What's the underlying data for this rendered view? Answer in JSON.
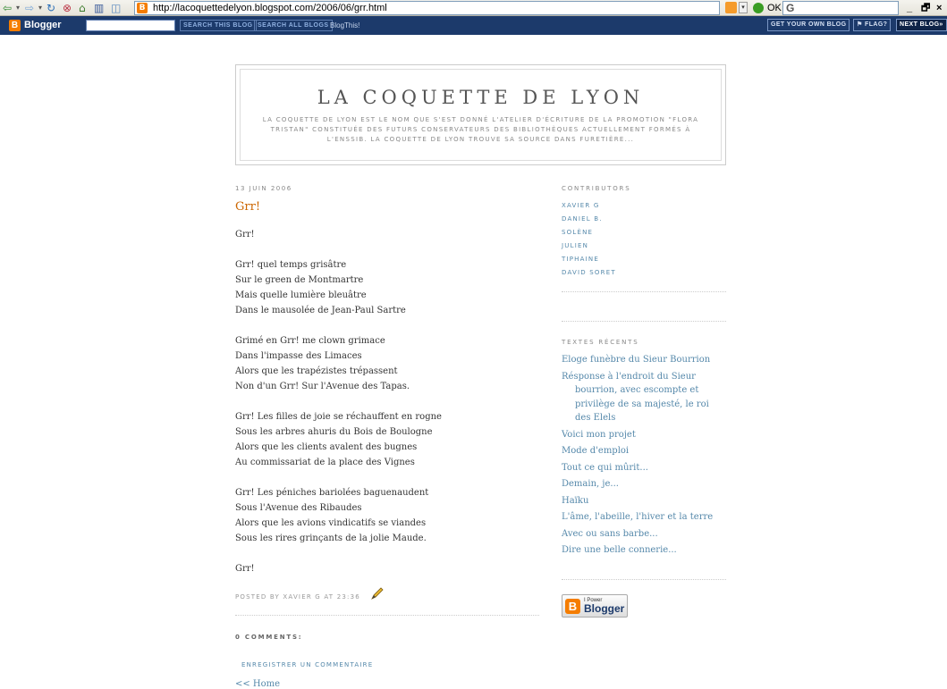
{
  "browser": {
    "url": "http://lacoquettedelyon.blogspot.com/2006/06/grr.html",
    "favicon_letter": "B",
    "go_label": "OK",
    "search_glyph": "G",
    "icons": [
      "back-arrow-icon",
      "forward-arrow-icon",
      "refresh-icon",
      "stop-icon",
      "home-icon",
      "media-icon"
    ]
  },
  "navbar": {
    "logo_letter": "B",
    "logo_text": "Blogger",
    "search_this_blog": "SEARCH THIS BLOG",
    "search_all_blogs": "SEARCH ALL BLOGS",
    "blogthis": "BlogThis!",
    "get_own_blog": "GET YOUR OWN BLOG",
    "flag": "⚑ FLAG?",
    "next_blog": "NEXT BLOG»"
  },
  "header": {
    "title": "LA COQUETTE DE LYON",
    "description": "LA COQUETTE DE LYON EST LE NOM QUE S'EST DONNÉ L'ATELIER D'ÉCRITURE DE LA PROMOTION \"FLORA TRISTAN\" CONSTITUÉE DES FUTURS CONSERVATEURS DES BIBLIOTHÈQUES ACTUELLEMENT FORMÉS À L'ENSSIB. LA COQUETTE DE LYON TROUVE SA SOURCE DANS FURETIÈRE..."
  },
  "post": {
    "date": "13 JUIN 2006",
    "title": "Grr!",
    "lines": [
      "Grr!",
      "",
      "Grr! quel temps grisâtre",
      "Sur le green de Montmartre",
      "Mais quelle lumière bleuâtre",
      "Dans le mausolée de Jean-Paul Sartre",
      "",
      "Grimé en Grr! me clown grimace",
      "Dans l'impasse des Limaces",
      "Alors que les trapézistes trépassent",
      "Non d'un Grr! Sur l'Avenue des Tapas.",
      "",
      "Grr! Les filles de joie se réchauffent en rogne",
      "Sous les arbres ahuris du Bois de Boulogne",
      "Alors que les clients avalent des bugnes",
      "Au commissariat de la place des Vignes",
      "",
      "Grr! Les péniches bariolées baguenaudent",
      "Sous l'Avenue des Ribaudes",
      "Alors que les avions vindicatifs se viandes",
      "Sous les rires grinçants de la jolie Maude.",
      "",
      "Grr!"
    ],
    "footer": "POSTED BY XAVIER G AT 23:36",
    "comments_heading": "0 COMMENTS:",
    "add_comment": "ENREGISTRER UN COMMENTAIRE",
    "home_link": "<< Home"
  },
  "sidebar": {
    "contributors_heading": "CONTRIBUTORS",
    "contributors": [
      "XAVIER G",
      "DANIEL B.",
      "SOLÈNE",
      "JULIEN",
      "TIPHAINE",
      "DAVID SORET"
    ],
    "recent_heading": "TEXTES RÉCENTS",
    "recent": [
      "Eloge funèbre du Sieur Bourrion",
      "Résponse à l'endroit du Sieur bourrion, avec escompte et privilège de sa majesté, le roi des Elels",
      "Voici mon projet",
      "Mode d'emploi",
      "Tout ce qui mûrit...",
      "Demain, je...",
      "Haïku",
      "L'âme, l'abeille, l'hiver et la terre",
      "Avec ou sans barbe...",
      "Dire une belle connerie..."
    ],
    "power_small": "I Power",
    "power_big": "Blogger",
    "power_letter": "B"
  }
}
